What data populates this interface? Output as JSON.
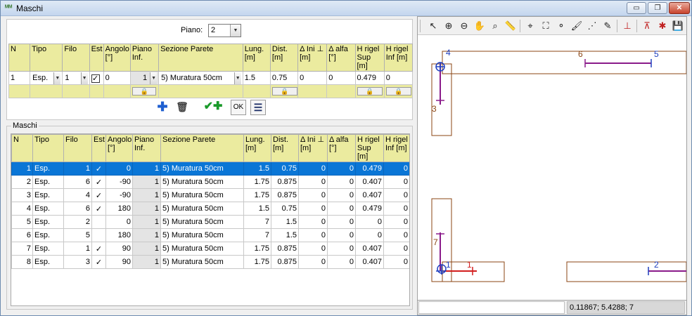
{
  "window": {
    "title": "Maschi",
    "min_label": "▭",
    "max_label": "❐",
    "close_label": "✕"
  },
  "form": {
    "piano_label": "Piano:",
    "piano_value": "2",
    "headers": [
      "N",
      "Tipo",
      "Filo",
      "Est",
      "Angolo [°]",
      "Piano Inf.",
      "Sezione Parete",
      "Lung. [m]",
      "Dist. [m]",
      "Δ Ini ⊥ [m]",
      "Δ alfa [°]",
      "H rigel Sup [m]",
      "H rigel Inf [m]"
    ],
    "row": {
      "n": "1",
      "tipo": "Esp.",
      "filo": "1",
      "est": "✓",
      "angolo": "0",
      "piano_inf": "1",
      "sezione": "5) Muratura 50cm",
      "lung": "1.5",
      "dist": "0.75",
      "d_ini": "0",
      "d_alfa": "0",
      "h_sup": "0.479",
      "h_inf": "0"
    },
    "lock_glyph": "🔒",
    "buttons": {
      "add": "✚",
      "delete": "🗑",
      "confirm_add": "✔✚",
      "ok": "OK",
      "list": "☰"
    }
  },
  "list": {
    "group_label": "Maschi",
    "headers": [
      "N",
      "Tipo",
      "Filo",
      "Est",
      "Angolo [°]",
      "Piano Inf.",
      "Sezione Parete",
      "Lung. [m]",
      "Dist. [m]",
      "Δ Ini ⊥ [m]",
      "Δ alfa [°]",
      "H rigel Sup [m]",
      "H rigel Inf [m]"
    ],
    "rows": [
      [
        "1",
        "Esp.",
        "1",
        "✓",
        "0",
        "1",
        "5) Muratura 50cm",
        "1.5",
        "0.75",
        "0",
        "0",
        "0.479",
        "0"
      ],
      [
        "2",
        "Esp.",
        "6",
        "✓",
        "-90",
        "1",
        "5) Muratura 50cm",
        "1.75",
        "0.875",
        "0",
        "0",
        "0.407",
        "0"
      ],
      [
        "3",
        "Esp.",
        "4",
        "✓",
        "-90",
        "1",
        "5) Muratura 50cm",
        "1.75",
        "0.875",
        "0",
        "0",
        "0.407",
        "0"
      ],
      [
        "4",
        "Esp.",
        "6",
        "✓",
        "180",
        "1",
        "5) Muratura 50cm",
        "1.5",
        "0.75",
        "0",
        "0",
        "0.479",
        "0"
      ],
      [
        "5",
        "Esp.",
        "2",
        "",
        "0",
        "1",
        "5) Muratura 50cm",
        "7",
        "1.5",
        "0",
        "0",
        "0",
        "0"
      ],
      [
        "6",
        "Esp.",
        "5",
        "",
        "180",
        "1",
        "5) Muratura 50cm",
        "7",
        "1.5",
        "0",
        "0",
        "0",
        "0"
      ],
      [
        "7",
        "Esp.",
        "1",
        "✓",
        "90",
        "1",
        "5) Muratura 50cm",
        "1.75",
        "0.875",
        "0",
        "0",
        "0.407",
        "0"
      ],
      [
        "8",
        "Esp.",
        "3",
        "✓",
        "90",
        "1",
        "5) Muratura 50cm",
        "1.75",
        "0.875",
        "0",
        "0",
        "0.407",
        "0"
      ]
    ]
  },
  "viewer": {
    "node_labels": [
      "4",
      "6",
      "5",
      "3",
      "7",
      "1",
      "1",
      "2"
    ],
    "status_coords": "0.11867; 5.4288; 7",
    "colors": {
      "wall": "#8b4513",
      "node": "#1f3fbf",
      "element": "#8a1a8a",
      "active": "#d21d1d"
    }
  },
  "colors": {
    "header_bg": "#ebeb9f",
    "selection": "#0a76d6"
  }
}
